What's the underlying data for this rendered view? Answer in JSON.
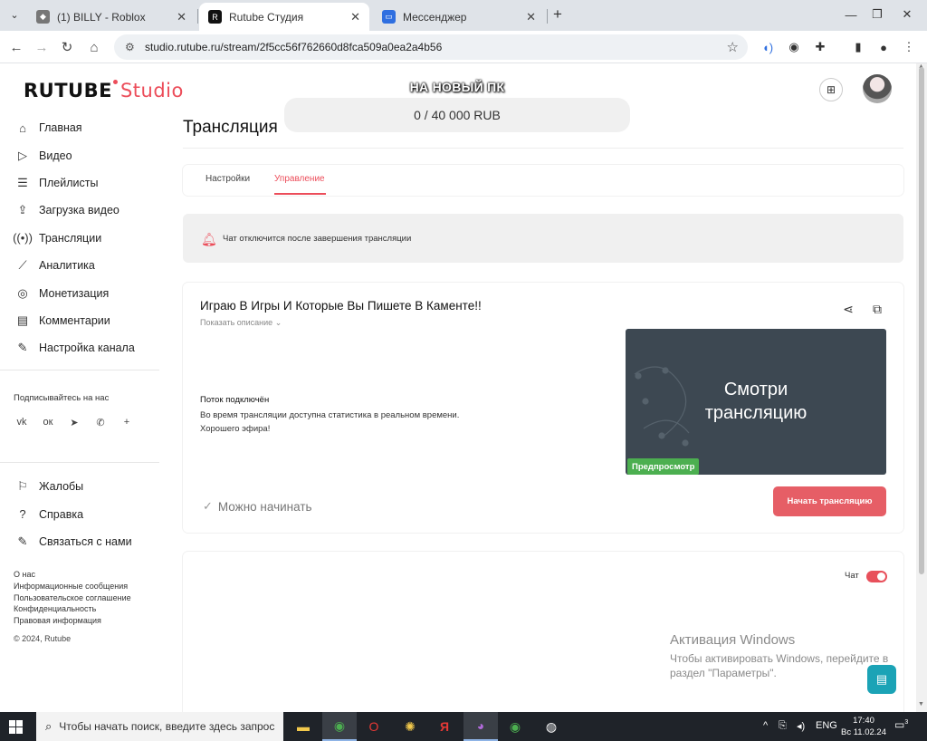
{
  "browser": {
    "tabs": [
      {
        "label": "(1) BILLY - Roblox",
        "icon": "roblox-icon"
      },
      {
        "label": "Rutube Студия",
        "icon": "rutube-icon"
      },
      {
        "label": "Мессенджер",
        "icon": "messenger-icon"
      }
    ],
    "url": "studio.rutube.ru/stream/2f5cc56f762660d8fca509a0ea2a4b56"
  },
  "logo": {
    "brand": "RUTUBE",
    "product": "Studio"
  },
  "donation": {
    "title": "НА НОВЫЙ ПК",
    "amount": "0 / 40 000 RUB"
  },
  "sidebar": {
    "items": [
      {
        "label": "Главная",
        "icon": "home-icon"
      },
      {
        "label": "Видео",
        "icon": "video-icon"
      },
      {
        "label": "Плейлисты",
        "icon": "playlist-icon"
      },
      {
        "label": "Загрузка видео",
        "icon": "upload-icon"
      },
      {
        "label": "Трансляции",
        "icon": "broadcast-icon"
      },
      {
        "label": "Аналитика",
        "icon": "analytics-icon"
      },
      {
        "label": "Монетизация",
        "icon": "monetization-icon"
      },
      {
        "label": "Комментарии",
        "icon": "comments-icon"
      },
      {
        "label": "Настройка канала",
        "icon": "channel-settings-icon"
      }
    ],
    "subscribe_title": "Подписывайтесь на нас",
    "socials": [
      "vk-icon",
      "odnoklassniki-icon",
      "telegram-icon",
      "viber-icon",
      "plus-icon"
    ],
    "bottom_items": [
      {
        "label": "Жалобы",
        "icon": "flag-icon"
      },
      {
        "label": "Справка",
        "icon": "help-icon"
      },
      {
        "label": "Связаться с нами",
        "icon": "edit-icon"
      }
    ],
    "footer_links": [
      "О нас",
      "Информационные сообщения",
      "Пользовательское соглашение",
      "Конфиденциальность",
      "Правовая информация"
    ],
    "copyright": "© 2024, Rutube"
  },
  "page": {
    "title": "Трансляция",
    "tabs": [
      "Настройки",
      "Управление"
    ],
    "active_tab": "Управление",
    "notice": "Чат отключится после завершения трансляции"
  },
  "stream": {
    "title": "Играю В Игры И Которые Вы Пишете В Каменте!!",
    "show_description": "Показать описание",
    "status_title": "Поток подключён",
    "status_line1": "Во время трансляции доступна статистика в реальном времени.",
    "status_line2": "Хорошего эфира!",
    "ready": "Можно начинать",
    "preview_line1": "Смотри",
    "preview_line2": "трансляцию",
    "preview_badge": "Предпросмотр",
    "start_button": "Начать трансляцию"
  },
  "chat": {
    "label": "Чат",
    "enabled": true
  },
  "activation": {
    "title": "Активация Windows",
    "line1": "Чтобы активировать Windows, перейдите в",
    "line2": "раздел \"Параметры\"."
  },
  "taskbar": {
    "search_placeholder": "Чтобы начать поиск, введите здесь запрос",
    "lang": "ENG",
    "time": "17:40",
    "date": "Вс 11.02.24",
    "notif_count": "3"
  },
  "colors": {
    "accent": "#ec4d5a",
    "success": "#4caf50",
    "fab": "#1ba3b6"
  }
}
